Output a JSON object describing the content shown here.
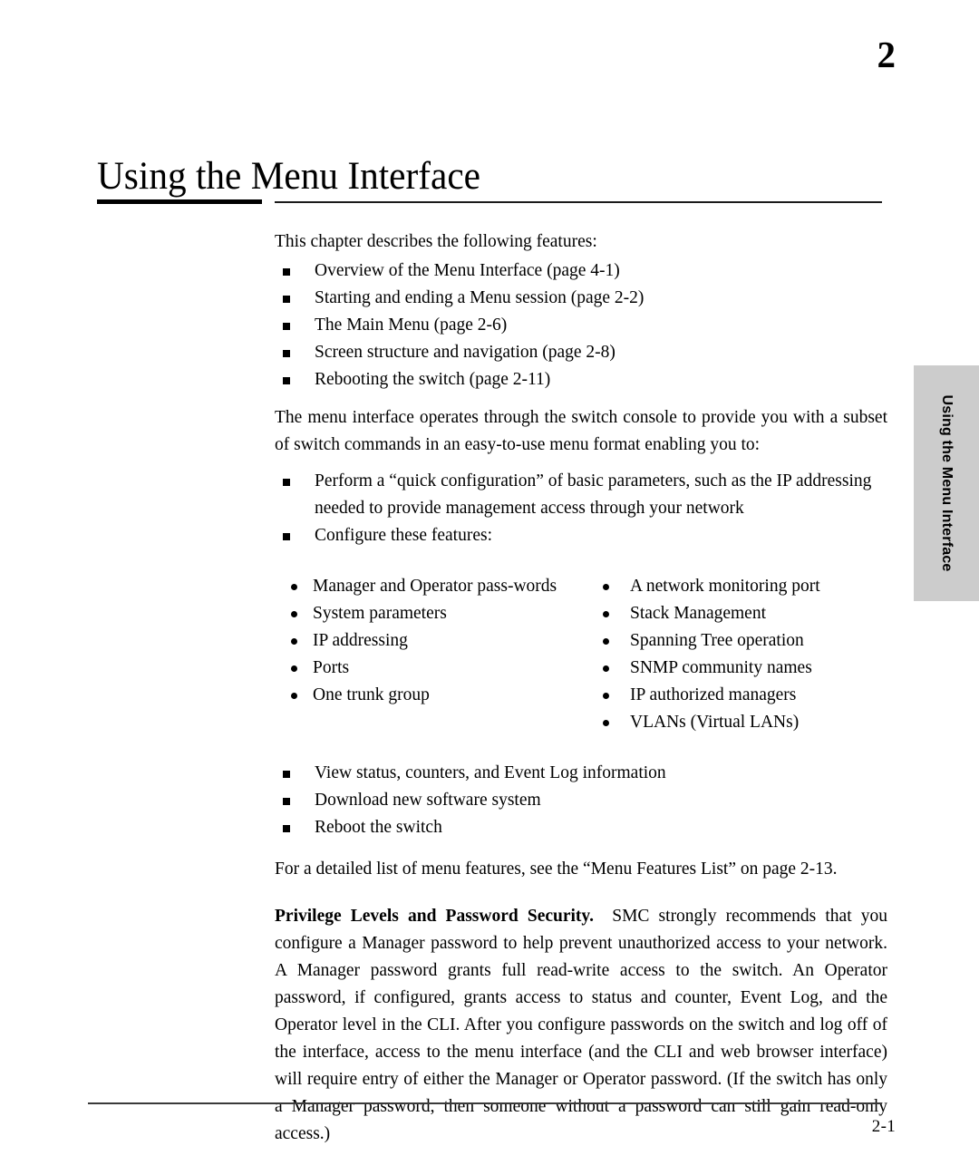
{
  "page": {
    "chapter_number": "2",
    "chapter_title": "Using the Menu Interface",
    "page_number": "2-1",
    "side_tab_label": "Using the Menu Interface"
  },
  "intro": {
    "lead": "This chapter describes the following features:",
    "features": [
      "Overview of the Menu Interface (page 4-1)",
      "Starting and ending a Menu session (page 2-2)",
      "The Main Menu (page 2-6)",
      "Screen structure and navigation (page 2-8)",
      "Rebooting the switch (page 2-11)"
    ]
  },
  "overview": {
    "paragraph": "The menu interface operates through the switch console to provide you with a subset of switch commands in an easy-to-use menu format enabling you to:",
    "capabilities_top": [
      "Perform a “quick configuration” of basic parameters, such as the IP addressing needed to provide management access through your network",
      "Configure these features:"
    ],
    "features_left": [
      "Manager and Operator pass-words",
      "System parameters",
      "IP addressing",
      "Ports",
      "One trunk group"
    ],
    "features_right": [
      "A network monitoring port",
      "Stack Management",
      "Spanning Tree operation",
      "SNMP community names",
      "IP authorized managers",
      "VLANs (Virtual LANs)"
    ],
    "capabilities_bottom": [
      "View status, counters, and Event Log information",
      "Download new software system",
      "Reboot the switch"
    ],
    "reference": "For a detailed list of menu features, see the “Menu Features List” on page 2-13."
  },
  "privilege": {
    "heading": "Privilege Levels and Password Security.",
    "body": "SMC strongly recommends that you configure a Manager password to help prevent unauthorized access to your network. A Manager password grants full read-write access to the switch. An Operator password, if configured, grants access to status and counter, Event Log, and the Operator level in the CLI. After you configure passwords on the switch and log off of the interface, access to the menu interface (and the CLI and web browser interface) will require entry of either the Manager or Operator password. (If the switch has only a Manager password, then someone without a password can still gain read-only access.)"
  },
  "colors": {
    "side_tab_bg": "#cccccc",
    "text": "#000000",
    "rule": "#1a1a1a"
  }
}
